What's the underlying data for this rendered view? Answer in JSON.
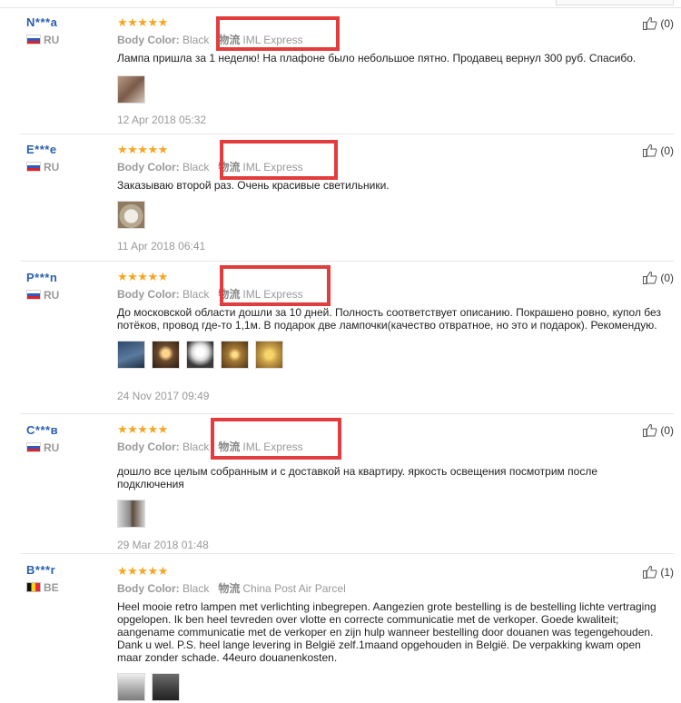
{
  "meta_label": "Body Color:",
  "reviews": [
    {
      "user": "N***a",
      "country": "RU",
      "flag": "ru",
      "color": "Black",
      "ship_icon": "物流",
      "shipping": "IML Express",
      "helpful": "(0)",
      "text": "Лампа пришла за 1 неделю! На плафоне было небольшое пятно. Продавец вернул 300 руб. Спасибо.",
      "photos": 1,
      "date": "12 Apr 2018 05:32"
    },
    {
      "user": "E***e",
      "country": "RU",
      "flag": "ru",
      "color": "Black",
      "ship_icon": "物流",
      "shipping": "IML Express",
      "helpful": "(0)",
      "text": "Заказываю второй раз. Очень красивые светильники.",
      "photos": 1,
      "date": "11 Apr 2018 06:41"
    },
    {
      "user": "P***n",
      "country": "RU",
      "flag": "ru",
      "color": "Black",
      "ship_icon": "物流",
      "shipping": "IML Express",
      "helpful": "(0)",
      "text": "До московской области дошли за 10 дней. Полность соответствует описанию. Покрашено ровно, купол без потёков, провод где-то 1,1м. В подарок две лампочки(качество отвратное, но это и подарок). Рекомендую.",
      "photos": 5,
      "date": "24 Nov 2017 09:49"
    },
    {
      "user": "C***в",
      "country": "RU",
      "flag": "ru",
      "color": "Black",
      "ship_icon": "物流",
      "shipping": "IML Express",
      "helpful": "(0)",
      "text": "дошло все целым собранным и с доставкой на квартиру. яркость освещения посмотрим после подключения",
      "photos": 1,
      "date": "29 Mar 2018 01:48"
    },
    {
      "user": "B***r",
      "country": "BE",
      "flag": "be",
      "color": "Black",
      "ship_icon": "物流",
      "shipping": "China Post Air Parcel",
      "helpful": "(1)",
      "text": "Heel mooie retro lampen met verlichting inbegrepen. Aangezien grote bestelling is de bestelling lichte vertraging opgelopen. Ik ben heel tevreden over vlotte en correcte communicatie met de verkoper. Goede kwaliteit; aangename communicatie met de verkoper en zijn hulp wanneer bestelling door douanen was tegengehouden. Dank u wel. P.S. heel lange levering in België zelf.1maand opgehouden in België. De verpakking kwam open maar zonder schade. 44euro douanenkosten.",
      "photos": 2,
      "date": ""
    }
  ]
}
